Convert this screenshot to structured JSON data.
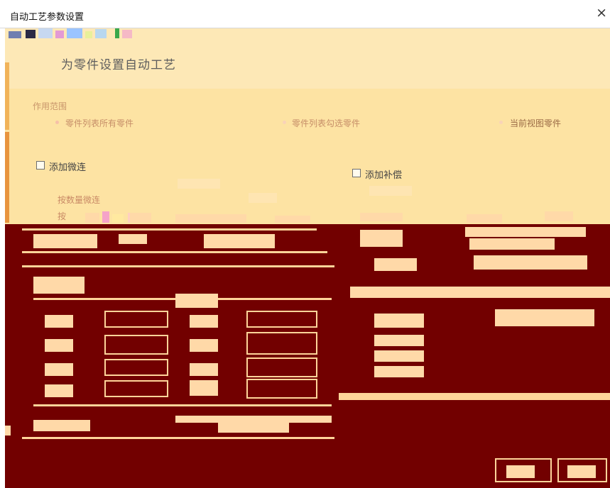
{
  "window": {
    "title": "自动工艺参数设置",
    "close_glyph": "×"
  },
  "header": {
    "text": "为零件设置自动工艺"
  },
  "scope": {
    "label": "作用范围",
    "options": [
      {
        "label": "零件列表所有零件"
      },
      {
        "label": "零件列表勾选零件"
      },
      {
        "label": "当前视图零件"
      }
    ]
  },
  "options": {
    "add_microjoint": "添加微连",
    "add_compensation": "添加补偿",
    "by_count_microjoint": "按数量微连",
    "by_count_fragment": "按"
  },
  "colors": {
    "dialog_bg": "#ffffff",
    "upper_bg": "#fde6ad",
    "lower_bg": "#720000",
    "garble": "#ffd7a0"
  },
  "icons": {
    "close": "close-icon",
    "checkbox": "checkbox-icon",
    "radio": "radio-icon"
  }
}
